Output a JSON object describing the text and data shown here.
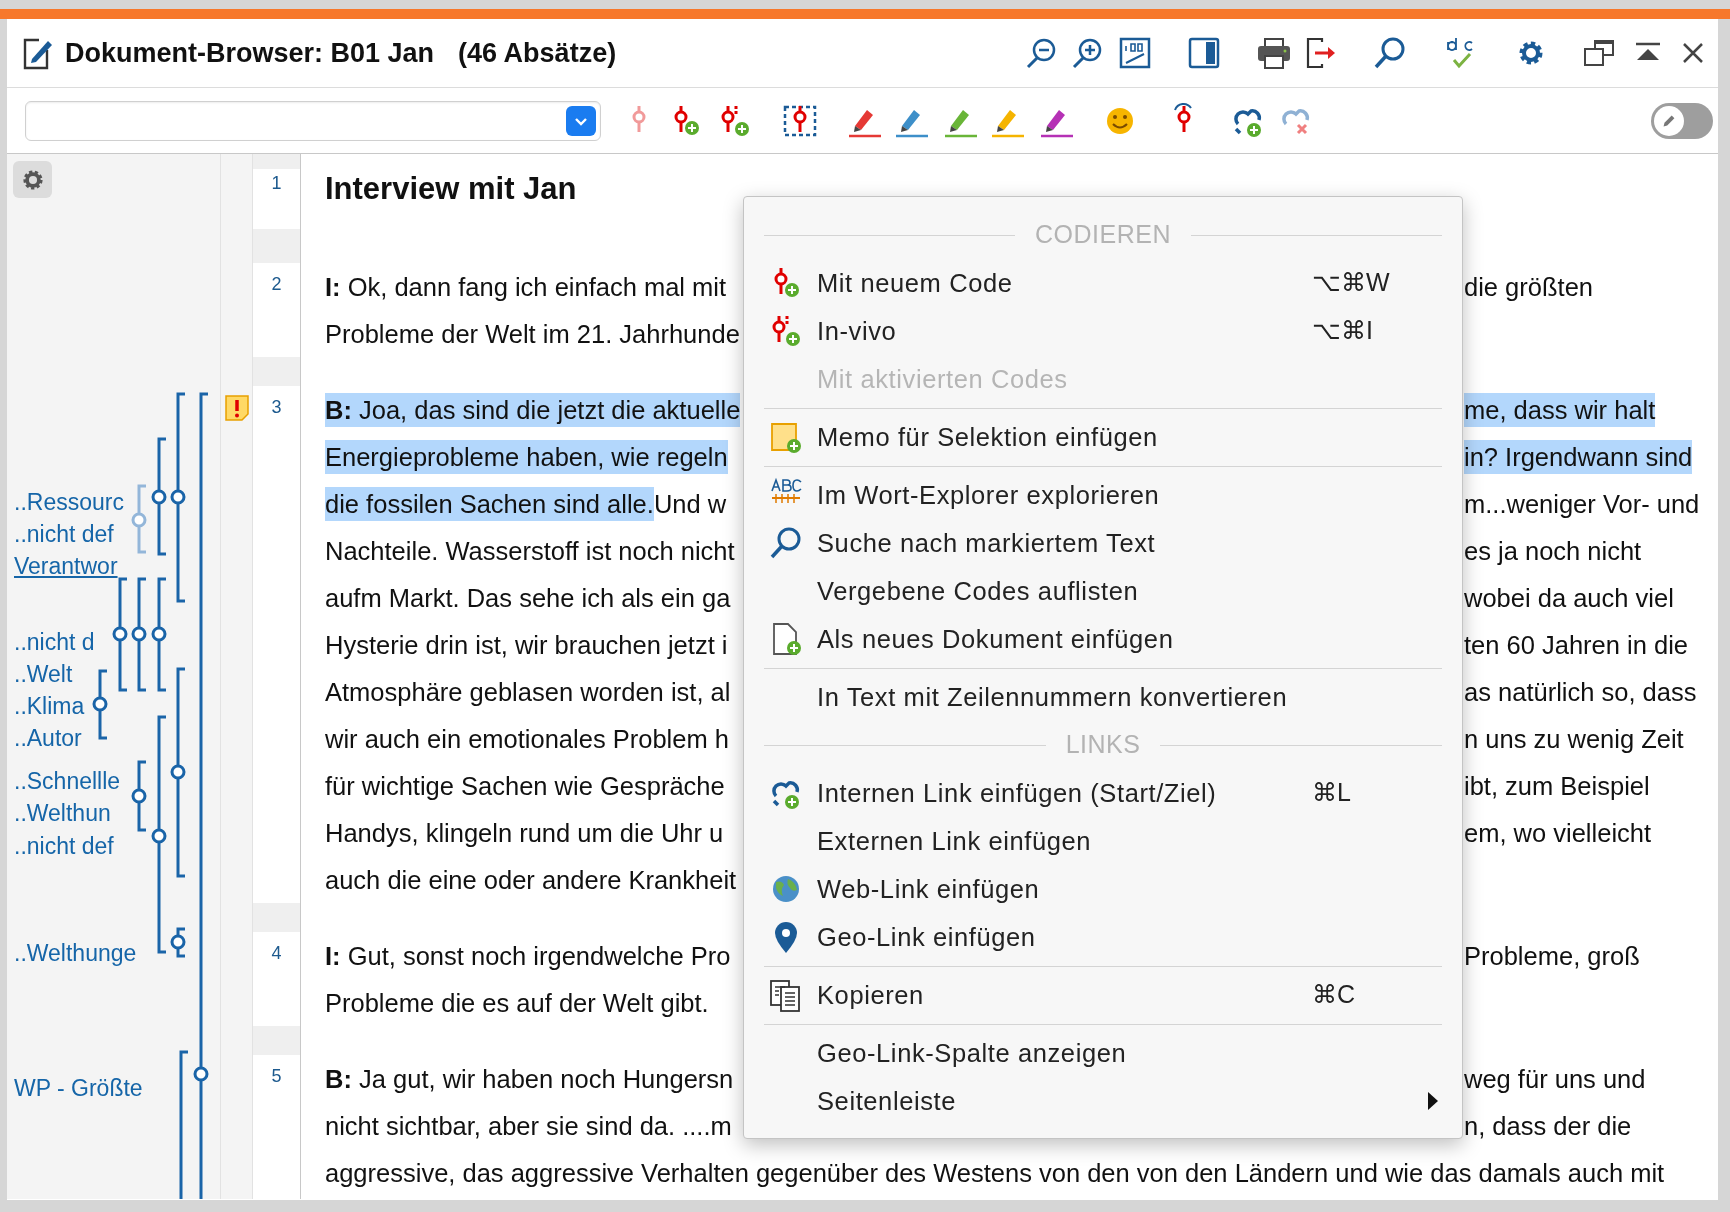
{
  "window": {
    "title": "Dokument-Browser: B01 Jan",
    "count": "(46 Absätze)"
  },
  "edit_toggle": {
    "on": false
  },
  "codes": [
    {
      "label": "..Ressourc",
      "selected": false
    },
    {
      "label": "..nicht def",
      "selected": false
    },
    {
      "label": "Verantwor",
      "selected": true
    },
    {
      "label": "..nicht d",
      "selected": false
    },
    {
      "label": "..Welt",
      "selected": false
    },
    {
      "label": "..Klima",
      "selected": false
    },
    {
      "label": "..Autor",
      "selected": false
    },
    {
      "label": "..Schnellle",
      "selected": false
    },
    {
      "label": "..Welthun",
      "selected": false
    },
    {
      "label": "..nicht def",
      "selected": false
    },
    {
      "label": "..Welthunge",
      "selected": false
    },
    {
      "label": "WP - Größte",
      "selected": false
    }
  ],
  "paragraphs": [
    {
      "number": "1",
      "kind": "title",
      "has_memo": false,
      "lines": [
        {
          "left": [
            {
              "text": "Interview mit Jan",
              "highlighted": false
            }
          ]
        }
      ]
    },
    {
      "number": "2",
      "kind": "text",
      "has_memo": false,
      "lines": [
        {
          "left": [
            {
              "text": "**I:** Ok, dann fang ich einfach mal mit",
              "highlighted": false
            }
          ],
          "right": [
            {
              "text": "die größten",
              "highlighted": false
            }
          ]
        },
        {
          "left": [
            {
              "text": "Probleme der Welt im 21. Jahrhunde",
              "highlighted": false
            }
          ]
        }
      ]
    },
    {
      "number": "3",
      "kind": "text",
      "has_memo": true,
      "lines": [
        {
          "left": [
            {
              "text": "**B:** Joa, das sind die jetzt die aktuelle",
              "highlighted": true
            }
          ],
          "right": [
            {
              "text": "me, dass wir halt",
              "highlighted": true
            }
          ]
        },
        {
          "left": [
            {
              "text": "Energieprobleme haben, wie regeln",
              "highlighted": true
            }
          ],
          "right": [
            {
              "text": "in? Irgendwann sind",
              "highlighted": true
            }
          ]
        },
        {
          "left": [
            {
              "text": "die fossilen Sachen sind alle.",
              "highlighted": true
            },
            {
              "text": " Und w",
              "highlighted": false
            }
          ],
          "right": [
            {
              "text": "m...weniger Vor- und",
              "highlighted": false
            }
          ]
        },
        {
          "left": [
            {
              "text": "Nachteile. Wasserstoff ist noch nicht",
              "highlighted": false
            }
          ],
          "right": [
            {
              "text": "es ja noch nicht",
              "highlighted": false
            }
          ]
        },
        {
          "left": [
            {
              "text": "aufm Markt. Das sehe ich als ein ga",
              "highlighted": false
            }
          ],
          "right": [
            {
              "text": "wobei da auch viel",
              "highlighted": false
            }
          ]
        },
        {
          "left": [
            {
              "text": "Hysterie drin ist, wir brauchen jetzt i",
              "highlighted": false
            }
          ],
          "right": [
            {
              "text": "ten 60 Jahren in die",
              "highlighted": false
            }
          ]
        },
        {
          "left": [
            {
              "text": "Atmosphäre geblasen worden ist, al",
              "highlighted": false
            }
          ],
          "right": [
            {
              "text": "as natürlich so, dass",
              "highlighted": false
            }
          ]
        },
        {
          "left": [
            {
              "text": "wir auch ein emotionales Problem h",
              "highlighted": false
            }
          ],
          "right": [
            {
              "text": "n uns zu wenig Zeit",
              "highlighted": false
            }
          ]
        },
        {
          "left": [
            {
              "text": "für wichtige Sachen wie Gespräche",
              "highlighted": false
            }
          ],
          "right": [
            {
              "text": "ibt, zum Beispiel",
              "highlighted": false
            }
          ]
        },
        {
          "left": [
            {
              "text": "Handys, klingeln rund um die Uhr u",
              "highlighted": false
            }
          ],
          "right": [
            {
              "text": "em, wo vielleicht",
              "highlighted": false
            }
          ]
        },
        {
          "left": [
            {
              "text": "auch die eine oder andere Krankheit",
              "highlighted": false
            }
          ]
        }
      ]
    },
    {
      "number": "4",
      "kind": "text",
      "has_memo": false,
      "lines": [
        {
          "left": [
            {
              "text": "**I:** Gut, sonst noch irgendwelche Pro",
              "highlighted": false
            }
          ],
          "right": [
            {
              "text": "Probleme, groß",
              "highlighted": false
            }
          ]
        },
        {
          "left": [
            {
              "text": "Probleme die es auf der Welt gibt.",
              "highlighted": false
            }
          ]
        }
      ]
    },
    {
      "number": "5",
      "kind": "text",
      "has_memo": false,
      "lines": [
        {
          "left": [
            {
              "text": "**B:** Ja gut, wir haben noch Hungersn",
              "highlighted": false
            }
          ],
          "right": [
            {
              "text": "weg für uns und",
              "highlighted": false
            }
          ]
        },
        {
          "left": [
            {
              "text": "nicht sichtbar, aber sie sind da. ....m",
              "highlighted": false
            }
          ],
          "right": [
            {
              "text": "n, dass der die",
              "highlighted": false
            }
          ]
        },
        {
          "left": [
            {
              "text": "aggressive, das aggressive Verhalten gegenüber des Westens von den von den Ländern und wie das damals auch mit",
              "highlighted": false
            }
          ]
        }
      ]
    }
  ],
  "context_menu": {
    "items": [
      {
        "kind": "header",
        "label": "CODIEREN"
      },
      {
        "kind": "item",
        "label": "Mit neuem Code",
        "shortcut": "⌥⌘W",
        "disabled": false,
        "submenu": false
      },
      {
        "kind": "item",
        "label": "In-vivo",
        "shortcut": "⌥⌘I",
        "disabled": false,
        "submenu": false
      },
      {
        "kind": "item",
        "label": "Mit aktivierten Codes",
        "disabled": true,
        "submenu": false
      },
      {
        "kind": "separator"
      },
      {
        "kind": "item",
        "label": "Memo für Selektion einfügen",
        "disabled": false,
        "submenu": false
      },
      {
        "kind": "separator"
      },
      {
        "kind": "item",
        "label": "Im Wort-Explorer explorieren",
        "disabled": false,
        "submenu": false
      },
      {
        "kind": "item",
        "label": "Suche nach markiertem Text",
        "disabled": false,
        "submenu": false
      },
      {
        "kind": "item",
        "label": "Vergebene Codes auflisten",
        "disabled": false,
        "submenu": false
      },
      {
        "kind": "item",
        "label": "Als neues Dokument einfügen",
        "disabled": false,
        "submenu": false
      },
      {
        "kind": "separator"
      },
      {
        "kind": "item",
        "label": "In Text mit Zeilennummern konvertieren",
        "disabled": false,
        "submenu": false
      },
      {
        "kind": "header",
        "label": "LINKS"
      },
      {
        "kind": "item",
        "label": "Internen Link einfügen (Start/Ziel)",
        "shortcut": "⌘L",
        "disabled": false,
        "submenu": false
      },
      {
        "kind": "item",
        "label": "Externen Link einfügen",
        "disabled": false,
        "submenu": false
      },
      {
        "kind": "item",
        "label": "Web-Link einfügen",
        "disabled": false,
        "submenu": false
      },
      {
        "kind": "item",
        "label": "Geo-Link einfügen",
        "disabled": false,
        "submenu": false
      },
      {
        "kind": "separator"
      },
      {
        "kind": "item",
        "label": "Kopieren",
        "shortcut": "⌘C",
        "disabled": false,
        "submenu": false
      },
      {
        "kind": "separator"
      },
      {
        "kind": "item",
        "label": "Geo-Link-Spalte anzeigen",
        "disabled": false,
        "submenu": false
      },
      {
        "kind": "item",
        "label": "Seitenleiste",
        "disabled": false,
        "submenu": true
      }
    ]
  }
}
